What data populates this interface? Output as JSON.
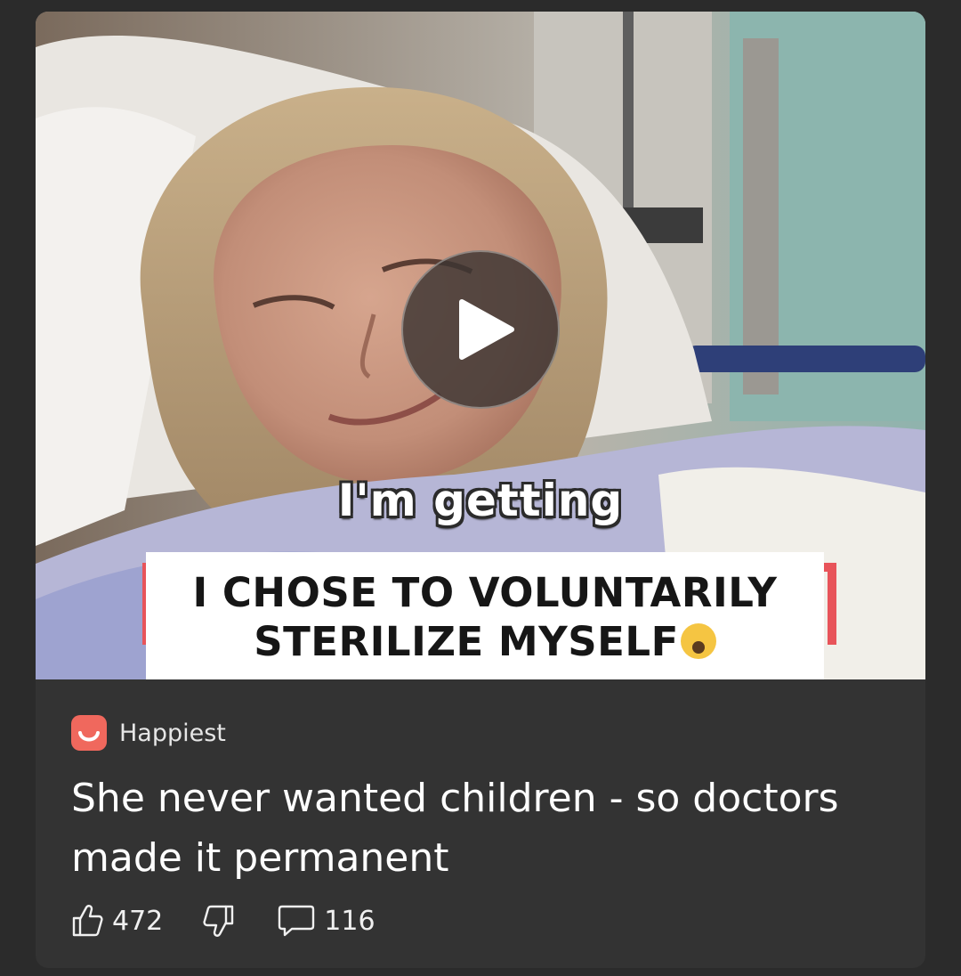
{
  "video": {
    "caption_top": "I'm getting",
    "banner_line1": "I CHOSE TO VOLUNTARILY",
    "banner_line2": "STERILIZE MYSELF"
  },
  "source": {
    "name": "Happiest",
    "logo_color": "#f0685d"
  },
  "headline": "She never wanted children - so doctors made it permanent",
  "actions": {
    "like_count": "472",
    "comment_count": "116"
  },
  "icons": {
    "play": "play-icon",
    "like": "thumbs-up-icon",
    "dislike": "thumbs-down-icon",
    "comment": "comment-icon"
  },
  "colors": {
    "page_bg": "#2b2b2b",
    "card_bg": "#333333",
    "banner_accent": "#e8545a"
  }
}
